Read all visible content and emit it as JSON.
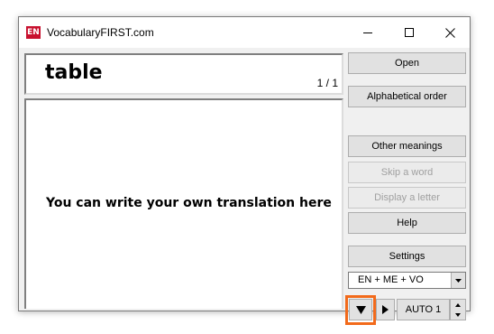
{
  "window": {
    "icon_text": "EN",
    "title": "VocabularyFIRST.com",
    "minimize_icon": "minimize-icon",
    "maximize_icon": "maximize-icon",
    "close_icon": "close-icon"
  },
  "word_panel": {
    "word": "table",
    "counter": "1 / 1"
  },
  "translation_panel": {
    "text": "You can write your own translation here"
  },
  "buttons": {
    "open": "Open",
    "alphabetical_order": "Alphabetical order",
    "other_meanings": "Other meanings",
    "skip_word": "Skip a word",
    "display_letter": "Display a letter",
    "help": "Help",
    "settings": "Settings"
  },
  "mode_select": {
    "selected": "EN  +  ME  +  VO"
  },
  "playback": {
    "down_icon": "triangle-down-icon",
    "play_icon": "play-icon",
    "auto_label": "AUTO 1",
    "highlight_color": "#f26a1b"
  }
}
